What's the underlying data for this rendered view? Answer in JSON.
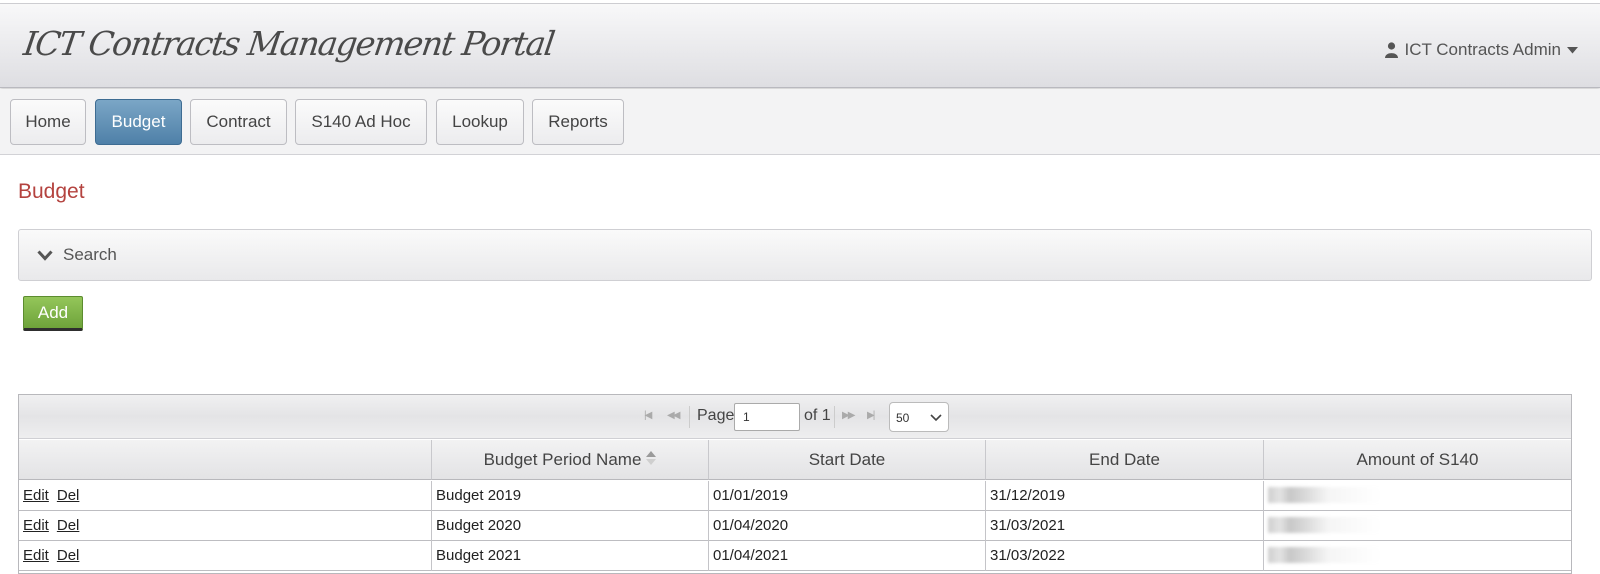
{
  "header": {
    "brand": "ICT Contracts Management Portal",
    "user_label": "ICT Contracts Admin"
  },
  "nav": {
    "items": [
      {
        "label": "Home",
        "active": false
      },
      {
        "label": "Budget",
        "active": true
      },
      {
        "label": "Contract",
        "active": false
      },
      {
        "label": "S140 Ad Hoc",
        "active": false
      },
      {
        "label": "Lookup",
        "active": false
      },
      {
        "label": "Reports",
        "active": false
      }
    ]
  },
  "main": {
    "title": "Budget",
    "search_label": "Search",
    "add_label": "Add"
  },
  "pager": {
    "page_label": "Page",
    "page_value": "1",
    "of_label": "of 1",
    "page_size": "50"
  },
  "table": {
    "columns": [
      "",
      "Budget Period Name",
      "Start Date",
      "End Date",
      "Amount of S140"
    ],
    "sorted_column": "Budget Period Name",
    "row_actions": {
      "edit": "Edit",
      "del": "Del"
    },
    "rows": [
      {
        "name": "Budget 2019",
        "start": "01/01/2019",
        "end": "31/12/2019",
        "amount": ""
      },
      {
        "name": "Budget 2020",
        "start": "01/04/2020",
        "end": "31/03/2021",
        "amount": ""
      },
      {
        "name": "Budget 2021",
        "start": "01/04/2021",
        "end": "31/03/2022",
        "amount": ""
      }
    ]
  },
  "colors": {
    "accent": "#4f80a8",
    "title": "#b4433f",
    "add_button": "#7ab446"
  },
  "icons": [
    "user-icon",
    "caret-down-icon",
    "chevron-down-icon",
    "first-page-icon",
    "prev-page-icon",
    "next-page-icon",
    "last-page-icon",
    "sort-icon"
  ]
}
